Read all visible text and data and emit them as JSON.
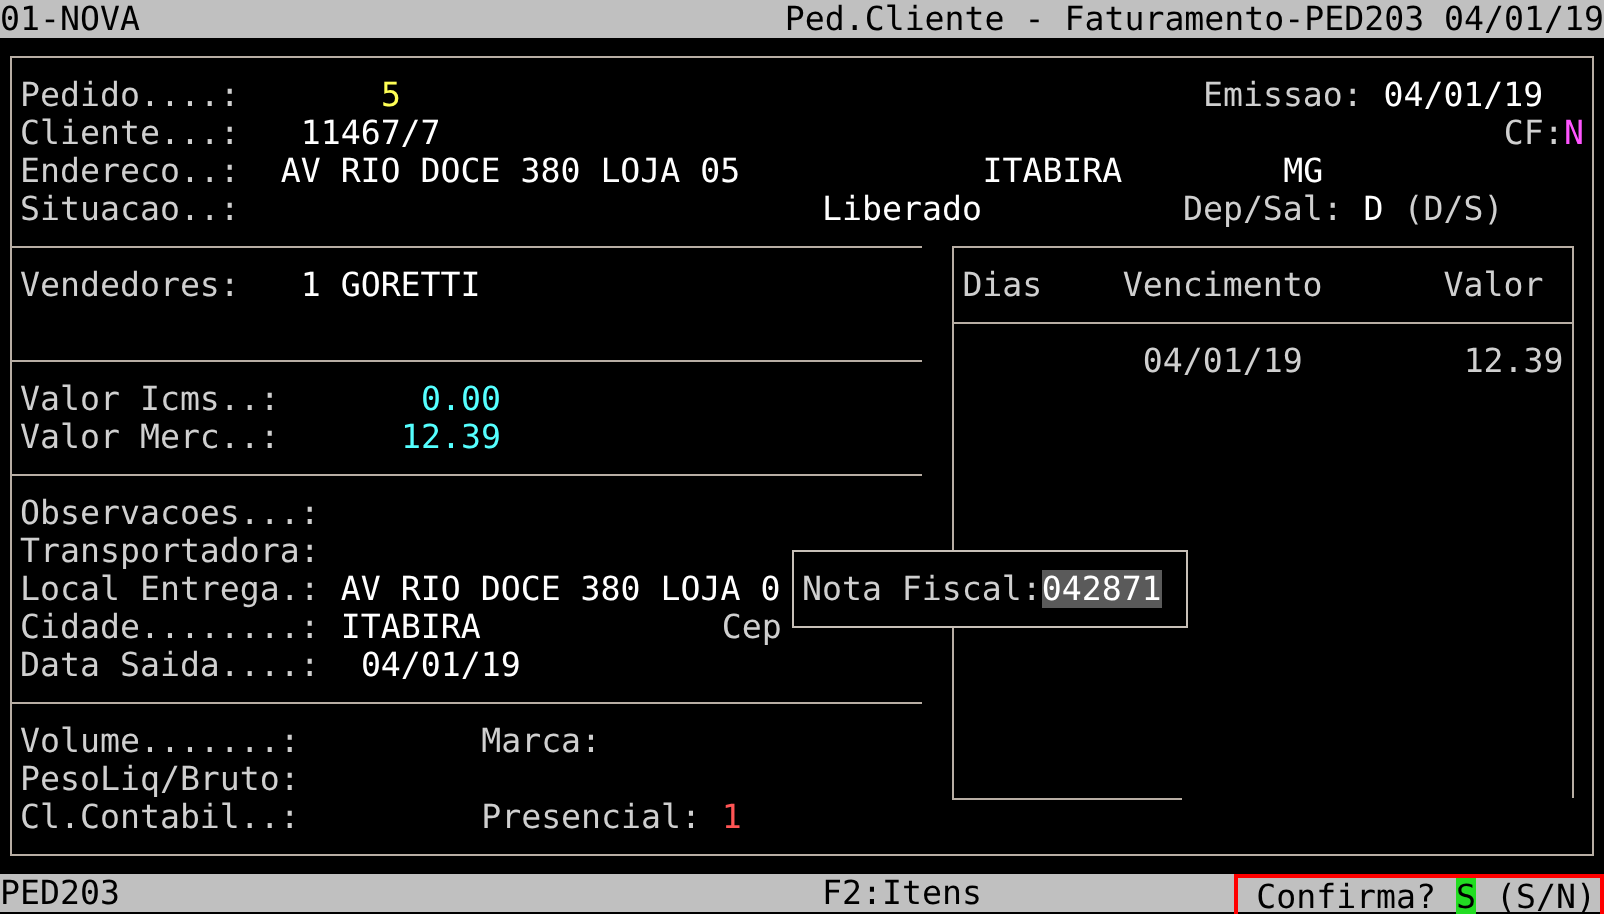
{
  "title_bar": {
    "left": "01-NOVA",
    "right": "Ped.Cliente - Faturamento-PED203 04/01/19"
  },
  "fields": [
    {
      "label": "Pedido....:",
      "value": "5",
      "color": "#ffff55"
    },
    {
      "label": "Emissao:",
      "value": "04/01/19"
    },
    {
      "label": "Cliente...:",
      "value": "11467/7"
    },
    {
      "label": "CF:",
      "value": "N",
      "color": "#ff55ff"
    },
    {
      "label": "Endereco..:",
      "value": "AV RIO DOCE 380 LOJA 05"
    },
    {
      "value": "ITABIRA"
    },
    {
      "value": "MG"
    },
    {
      "label": "Situacao..:",
      "value": "Liberado"
    },
    {
      "label": "Dep/Sal:",
      "value": "D"
    },
    {
      "label": "(D/S)"
    },
    {
      "label": "Vendedores:",
      "value": "1 GORETTI"
    },
    {
      "label": "Valor Icms..:",
      "value": "0.00",
      "color": "#55ffff"
    },
    {
      "label": "Valor Merc..:",
      "value": "12.39",
      "color": "#55ffff"
    },
    {
      "label": "Observacoes...:"
    },
    {
      "label": "Transportadora:"
    },
    {
      "label": "Local Entrega.:",
      "value": "AV RIO DOCE 380 LOJA 0"
    },
    {
      "label": "Cidade........:",
      "value": "ITABIRA"
    },
    {
      "label": "Cep"
    },
    {
      "label": "Data Saida....:",
      "value": "04/01/19"
    },
    {
      "label": "Volume.......:"
    },
    {
      "label": "Marca:"
    },
    {
      "label": "PesoLiq/Bruto:"
    },
    {
      "label": "Cl.Contabil..:"
    },
    {
      "label": "Presencial:",
      "value": "1",
      "color": "#ff5555"
    }
  ],
  "installments": {
    "columns": [
      "Dias",
      "Vencimento",
      "Valor"
    ],
    "rows": [
      {
        "due": "04/01/19",
        "amount": "12.39"
      }
    ]
  },
  "popup": {
    "label": "Nota Fiscal:",
    "value": "042871"
  },
  "status_bar": {
    "program": "PED203",
    "hint": "F2:Itens",
    "prompt": {
      "label": "Confirma?",
      "value": "S",
      "options": "(S/N)"
    }
  }
}
